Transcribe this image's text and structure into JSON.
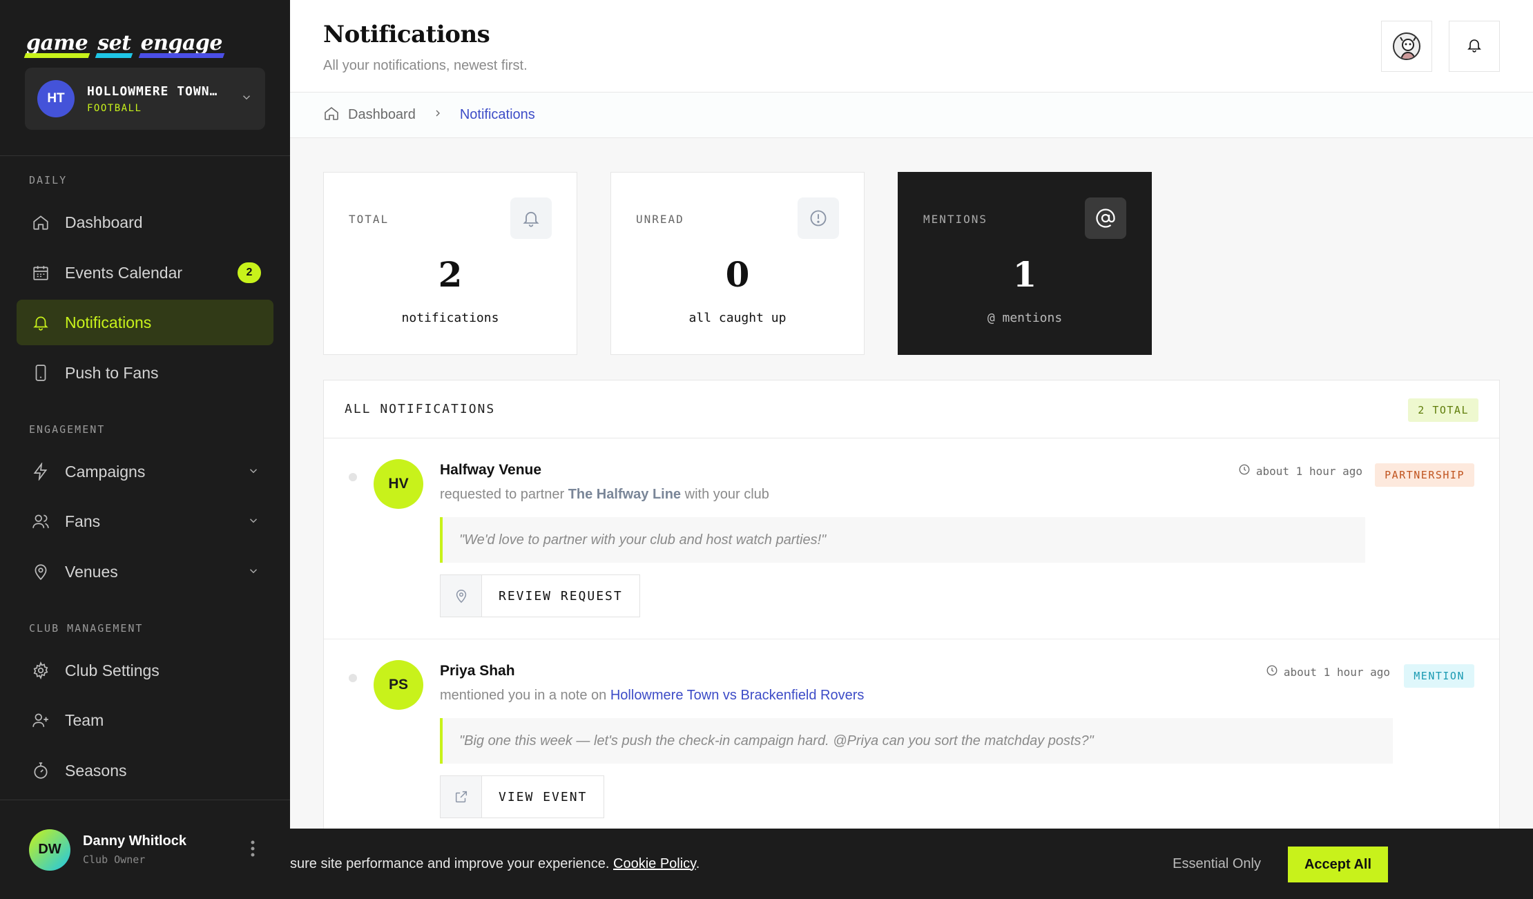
{
  "brand": {
    "logo_words": [
      "game",
      "set",
      "engage"
    ]
  },
  "club": {
    "initials": "HT",
    "name": "HOLLOWMERE TOWN…",
    "sport": "FOOTBALL"
  },
  "sidebar": {
    "sections": {
      "daily": "DAILY",
      "engagement": "ENGAGEMENT",
      "club_management": "CLUB MANAGEMENT"
    },
    "items": [
      {
        "label": "Dashboard",
        "icon": "home-icon"
      },
      {
        "label": "Events Calendar",
        "icon": "calendar-icon",
        "badge": "2"
      },
      {
        "label": "Notifications",
        "icon": "bell-icon",
        "active": true
      },
      {
        "label": "Push to Fans",
        "icon": "phone-icon"
      },
      {
        "label": "Campaigns",
        "icon": "lightning-icon",
        "expandable": true
      },
      {
        "label": "Fans",
        "icon": "users-icon",
        "expandable": true
      },
      {
        "label": "Venues",
        "icon": "map-pin-icon",
        "expandable": true
      },
      {
        "label": "Club Settings",
        "icon": "gear-icon"
      },
      {
        "label": "Team",
        "icon": "user-plus-icon"
      },
      {
        "label": "Seasons",
        "icon": "timer-icon"
      }
    ]
  },
  "user": {
    "initials": "DW",
    "name": "Danny Whitlock",
    "role": "Club Owner"
  },
  "header": {
    "title": "Notifications",
    "subtitle": "All your notifications, newest first."
  },
  "breadcrumb": {
    "home": "Dashboard",
    "current": "Notifications"
  },
  "stats": [
    {
      "label": "TOTAL",
      "value": "2",
      "caption": "notifications",
      "icon": "bell-icon"
    },
    {
      "label": "UNREAD",
      "value": "0",
      "caption": "all caught up",
      "icon": "alert-circle-icon"
    },
    {
      "label": "MENTIONS",
      "value": "1",
      "caption": "@ mentions",
      "icon": "at-sign-icon"
    }
  ],
  "panel": {
    "title": "ALL NOTIFICATIONS",
    "total_badge": "2 TOTAL"
  },
  "notifications": [
    {
      "initials": "HV",
      "name": "Halfway Venue",
      "text_before": "requested to partner",
      "highlight": "The Halfway Line",
      "text_after": "with your club",
      "time": "about 1 hour ago",
      "tag": "PARTNERSHIP",
      "quote": "\"We'd love to partner with your club and host watch parties!\"",
      "action": "REVIEW REQUEST",
      "action_icon": "map-pin-icon"
    },
    {
      "initials": "PS",
      "name": "Priya Shah",
      "text_before": "mentioned you in a note on",
      "highlight": "Hollowmere Town vs Brackenfield Rovers",
      "text_after": "",
      "time": "about 1 hour ago",
      "tag": "MENTION",
      "quote": "\"Big one this week — let's push the check-in campaign hard. @Priya can you sort the matchday posts?\"",
      "action": "VIEW EVENT",
      "action_icon": "external-link-icon"
    }
  ],
  "cookie": {
    "text": "sure site performance and improve your experience.",
    "link": "Cookie Policy",
    "period": ".",
    "essential": "Essential Only",
    "accept": "Accept All"
  },
  "colors": {
    "accent": "#c8f21b",
    "sidebar_bg": "#1c1c1c",
    "link": "#3d4cc7",
    "cyan": "#1fc6e6",
    "indigo": "#4b4fe6"
  }
}
